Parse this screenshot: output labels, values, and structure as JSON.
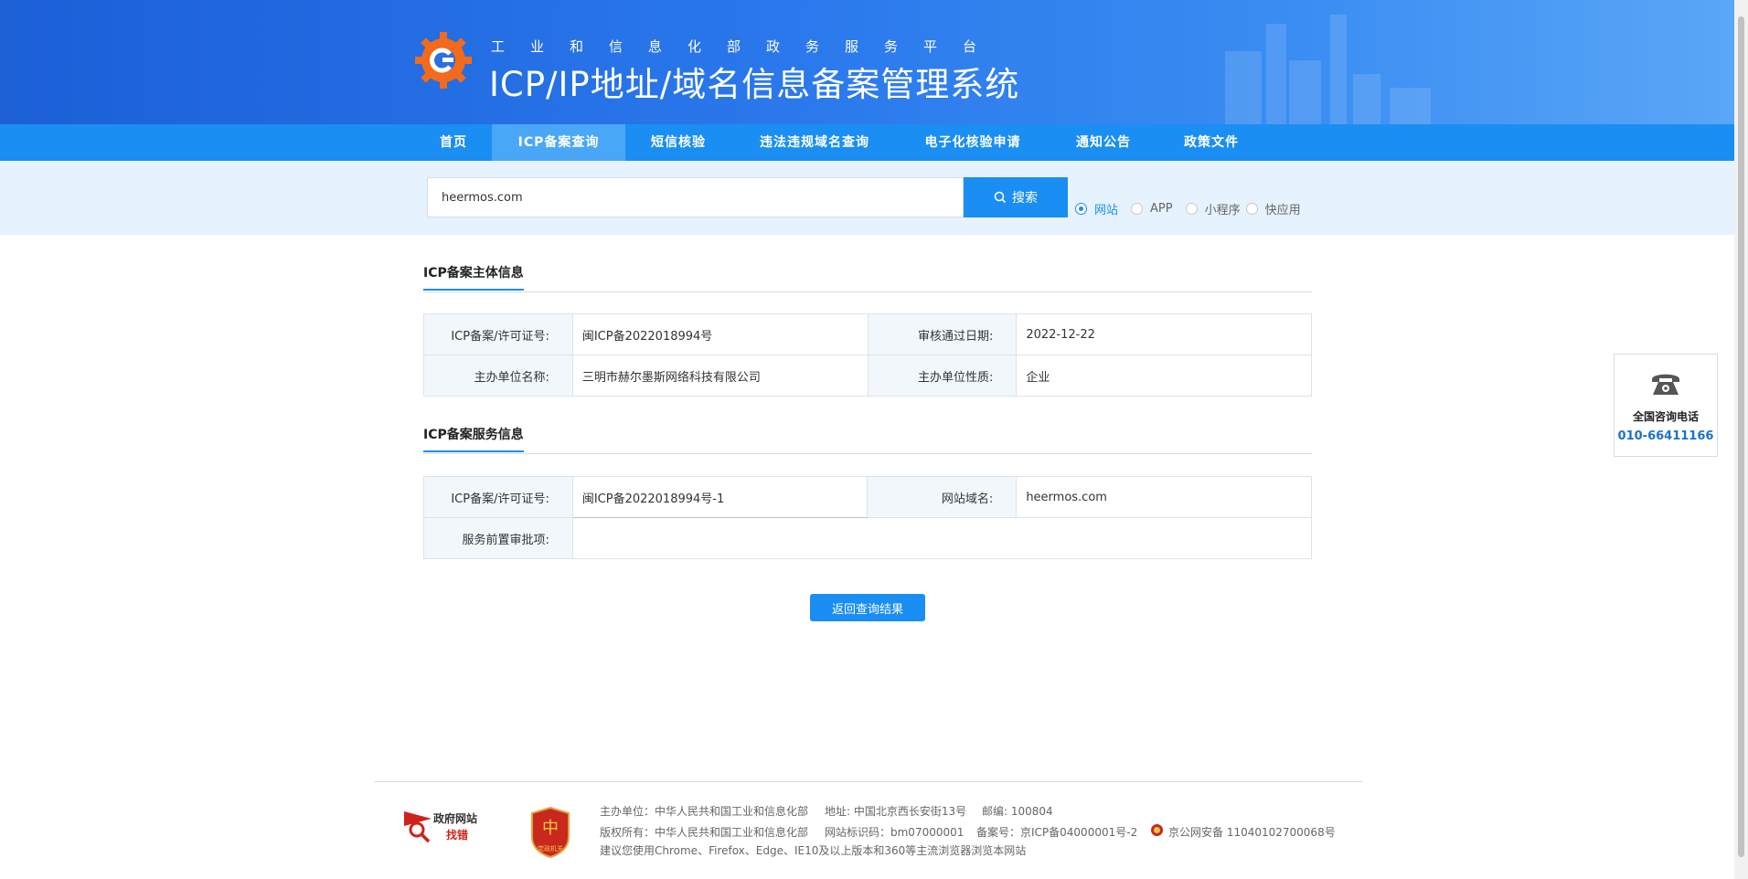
{
  "header": {
    "subtitle": "工业和信息化部政务服务平台",
    "title": "ICP/IP地址/域名信息备案管理系统"
  },
  "nav": {
    "items": [
      {
        "label": "首页"
      },
      {
        "label": "ICP备案查询"
      },
      {
        "label": "短信核验"
      },
      {
        "label": "违法违规域名查询"
      },
      {
        "label": "电子化核验申请"
      },
      {
        "label": "通知公告"
      },
      {
        "label": "政策文件"
      }
    ],
    "active": "ICP备案查询"
  },
  "search": {
    "value": "heermos.com",
    "button_label": "搜索",
    "options": [
      {
        "label": "网站",
        "checked": true
      },
      {
        "label": "APP",
        "checked": false
      },
      {
        "label": "小程序",
        "checked": false
      },
      {
        "label": "快应用",
        "checked": false
      }
    ]
  },
  "subject_info": {
    "title": "ICP备案主体信息",
    "rows": [
      {
        "label1": "ICP备案/许可证号:",
        "value1": "闽ICP备2022018994号",
        "label2": "审核通过日期:",
        "value2": "2022-12-22"
      },
      {
        "label1": "主办单位名称:",
        "value1": "三明市赫尔墨斯网络科技有限公司",
        "label2": "主办单位性质:",
        "value2": "企业"
      }
    ]
  },
  "service_info": {
    "title": "ICP备案服务信息",
    "license_label": "ICP备案/许可证号:",
    "license_value": "闽ICP备2022018994号-1",
    "domain_label": "网站域名:",
    "domain_value": "heermos.com",
    "approval_label": "服务前置审批项:",
    "approval_value": ""
  },
  "back_button": "返回查询结果",
  "consult": {
    "label": "全国咨询电话",
    "phone": "010-66411166"
  },
  "footer": {
    "gov_site_line1": "政府网站",
    "gov_site_line2": "找错",
    "badge_text": "党政机关",
    "sponsor": "主办单位：中华人民共和国工业和信息化部",
    "address": "地址: 中国北京西长安街13号",
    "postcode": "邮编: 100804",
    "copyright": "版权所有：中华人民共和国工业和信息化部",
    "site_code": "网站标识码：bm07000001",
    "icp": "备案号：京ICP备04000001号-2",
    "police": "京公网安备 11040102700068号",
    "browser_note": "建议您使用Chrome、Firefox、Edge、IE10及以上版本和360等主流浏览器浏览本网站"
  },
  "colors": {
    "brand_blue": "#1a8ef3",
    "banner_dark": "#1c5fd6",
    "logo_orange": "#f26a1b",
    "phone_blue": "#1a73c8",
    "gov_red": "#d0221c"
  },
  "icons": [
    "gear-logo-icon",
    "search-icon",
    "telephone-icon",
    "gov-site-icon",
    "party-badge-icon",
    "police-emblem-icon"
  ]
}
